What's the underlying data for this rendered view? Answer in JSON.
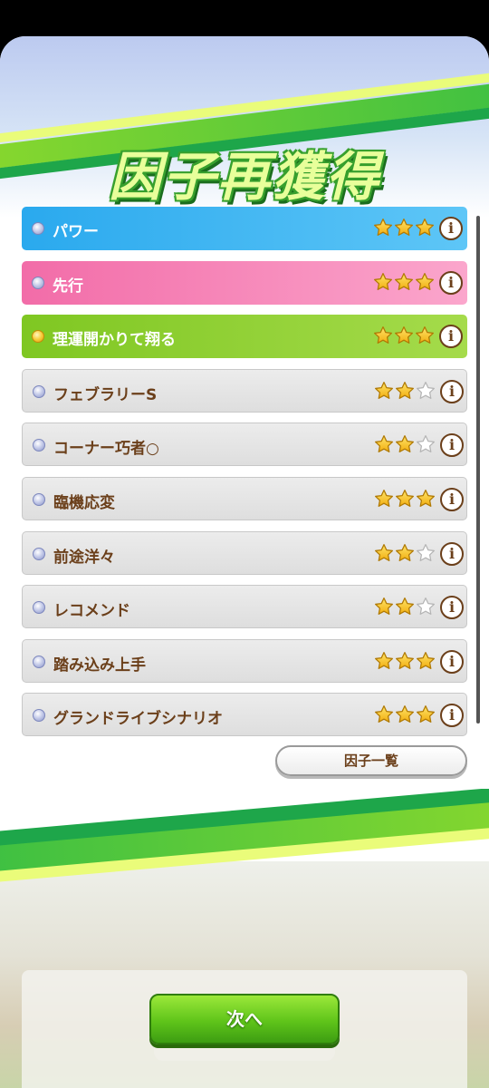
{
  "title": "因子再獲得",
  "factors": [
    {
      "name": "パワー",
      "color": "blue",
      "stars": 3
    },
    {
      "name": "先行",
      "color": "pink",
      "stars": 3
    },
    {
      "name": "理運開かりて翔る",
      "color": "green",
      "stars": 3
    },
    {
      "name": "フェブラリーS",
      "color": "gray",
      "stars": 2
    },
    {
      "name": "コーナー巧者○",
      "color": "gray",
      "stars": 2
    },
    {
      "name": "臨機応変",
      "color": "gray",
      "stars": 3
    },
    {
      "name": "前途洋々",
      "color": "gray",
      "stars": 2
    },
    {
      "name": "レコメンド",
      "color": "gray",
      "stars": 2
    },
    {
      "name": "踏み込み上手",
      "color": "gray",
      "stars": 3
    },
    {
      "name": "グランドライブシナリオ",
      "color": "gray",
      "stars": 3
    }
  ],
  "info_glyph": "i",
  "factor_list_label": "因子一覧",
  "next_label": "次へ",
  "colors": {
    "blue": "#2aa9ee",
    "pink": "#f26ca8",
    "green": "#7fc722",
    "gray": "#e4e4e4",
    "text_brown": "#6b3f1a",
    "star_gold": "#f5c21b"
  }
}
